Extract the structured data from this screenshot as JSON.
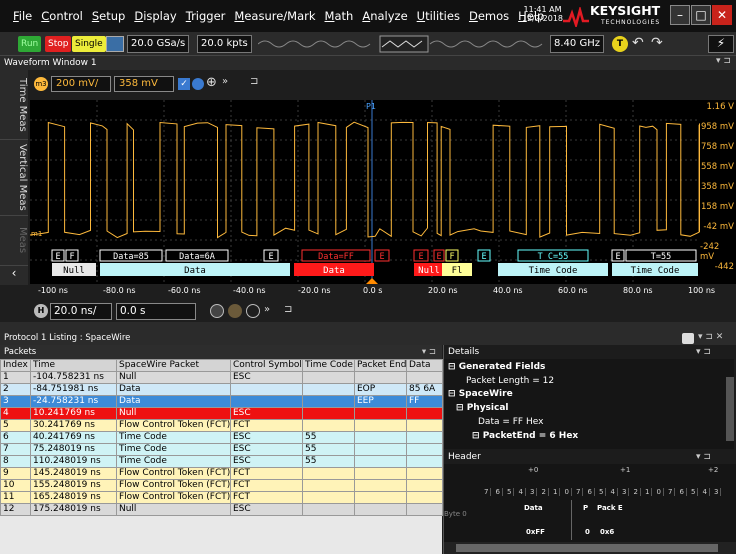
{
  "menu": {
    "items": [
      "File",
      "Control",
      "Setup",
      "Display",
      "Trigger",
      "Measure/Mark",
      "Math",
      "Analyze",
      "Utilities",
      "Demos",
      "Help"
    ]
  },
  "clock": {
    "time": "11:41 AM",
    "date": "12/2/2018"
  },
  "brand": {
    "name": "KEYSIGHT",
    "sub": "TECHNOLOGIES"
  },
  "toolbar": {
    "run": "Run",
    "stop": "Stop",
    "single": "Single",
    "sample_rate": "20.0 GSa/s",
    "points": "20.0 kpts",
    "bandwidth": "8.40 GHz",
    "trigger_badge": "T"
  },
  "window": {
    "title": "Waveform Window 1"
  },
  "sidetabs": [
    "Time Meas",
    "Vertical Meas",
    "Meas"
  ],
  "channel": {
    "badge": "m3",
    "scale": "200 mV/",
    "offset": "358 mV",
    "marker": "P1",
    "ref_label": "m1"
  },
  "voltage_labels": [
    "1.16 V",
    "958 mV",
    "758 mV",
    "558 mV",
    "358 mV",
    "158 mV",
    "-42 mV",
    "-242 mV",
    "-442"
  ],
  "time_labels": [
    "-100 ns",
    "-80.0 ns",
    "-60.0 ns",
    "-40.0 ns",
    "-20.0 ns",
    "0.0 s",
    "20.0 ns",
    "40.0 ns",
    "60.0 ns",
    "80.0 ns",
    "100 ns"
  ],
  "horizontal": {
    "badge": "H",
    "scale": "20.0 ns/",
    "position": "0.0 s"
  },
  "decode": {
    "row1": [
      {
        "text": "E",
        "color": "#ffffff",
        "bg": "#000"
      },
      {
        "text": "F",
        "color": "#ffffff",
        "bg": "#000"
      },
      {
        "text": "Data=85",
        "color": "#ffffff",
        "bg": "#000"
      },
      {
        "text": "Data=6A",
        "color": "#ffffff",
        "bg": "#000"
      },
      {
        "text": "E",
        "color": "#ffffff",
        "bg": "#000"
      },
      {
        "text": "Data=FF",
        "color": "#ff3030",
        "bg": "#000"
      },
      {
        "text": "E",
        "color": "#ff3030",
        "bg": "#000"
      },
      {
        "text": "E",
        "color": "#ff3030",
        "bg": "#000"
      },
      {
        "text": "E",
        "color": "#ff3030",
        "bg": "#000"
      },
      {
        "text": "F",
        "color": "#ffff66",
        "bg": "#000"
      },
      {
        "text": "E",
        "color": "#66ffff",
        "bg": "#000"
      },
      {
        "text": "T C=55",
        "color": "#66ffff",
        "bg": "#000"
      },
      {
        "text": "E",
        "color": "#ffffff",
        "bg": "#000"
      },
      {
        "text": "T=55",
        "color": "#ffffff",
        "bg": "#000"
      }
    ],
    "row2": [
      "Null",
      "Data",
      "Data",
      "Null",
      "Fl",
      "Time Code",
      "Time Code"
    ]
  },
  "listing": {
    "title": "Protocol 1 Listing : SpaceWire",
    "packets_label": "Packets",
    "columns": [
      "Index",
      "Time",
      "SpaceWire Packet",
      "Control Symbol",
      "Time Code",
      "Packet End",
      "Data"
    ],
    "rows": [
      {
        "c": [
          "1",
          "-104.758231 ns",
          "Null",
          "ESC",
          "",
          "",
          ""
        ],
        "bg": "#d9d9d9",
        "fg": "#000"
      },
      {
        "c": [
          "2",
          "-84.751981 ns",
          "Data",
          "",
          "",
          "EOP",
          "85 6A"
        ],
        "bg": "#cfe8f7",
        "fg": "#000"
      },
      {
        "c": [
          "3",
          "-24.758231 ns",
          "Data",
          "",
          "",
          "EEP",
          "FF"
        ],
        "bg": "#3d8bd8",
        "fg": "#fff"
      },
      {
        "c": [
          "4",
          "10.241769 ns",
          "Null",
          "ESC",
          "",
          "",
          ""
        ],
        "bg": "#ee1111",
        "fg": "#fff"
      },
      {
        "c": [
          "5",
          "30.241769 ns",
          "Flow Control Token (FCT)",
          "FCT",
          "",
          "",
          ""
        ],
        "bg": "#fff3b8",
        "fg": "#000"
      },
      {
        "c": [
          "6",
          "40.241769 ns",
          "Time Code",
          "ESC",
          "55",
          "",
          ""
        ],
        "bg": "#cff3f5",
        "fg": "#000"
      },
      {
        "c": [
          "7",
          "75.248019 ns",
          "Time Code",
          "ESC",
          "55",
          "",
          ""
        ],
        "bg": "#cff3f5",
        "fg": "#000"
      },
      {
        "c": [
          "8",
          "110.248019 ns",
          "Time Code",
          "ESC",
          "55",
          "",
          ""
        ],
        "bg": "#cff3f5",
        "fg": "#000"
      },
      {
        "c": [
          "9",
          "145.248019 ns",
          "Flow Control Token (FCT)",
          "FCT",
          "",
          "",
          ""
        ],
        "bg": "#fff3b8",
        "fg": "#000"
      },
      {
        "c": [
          "10",
          "155.248019 ns",
          "Flow Control Token (FCT)",
          "FCT",
          "",
          "",
          ""
        ],
        "bg": "#fff3b8",
        "fg": "#000"
      },
      {
        "c": [
          "11",
          "165.248019 ns",
          "Flow Control Token (FCT)",
          "FCT",
          "",
          "",
          ""
        ],
        "bg": "#fff3b8",
        "fg": "#000"
      },
      {
        "c": [
          "12",
          "175.248019 ns",
          "Null",
          "ESC",
          "",
          "",
          ""
        ],
        "bg": "#d9d9d9",
        "fg": "#000"
      }
    ]
  },
  "details": {
    "title": "Details",
    "lines": [
      "Generated Fields",
      "Packet Length = 12",
      "SpaceWire",
      "Physical",
      "Data = FF Hex",
      "PacketEnd = 6 Hex"
    ]
  },
  "header": {
    "title": "Header",
    "offsets": [
      "+0",
      "+1",
      "+2"
    ],
    "bits": [
      "7",
      "6",
      "5",
      "4",
      "3",
      "2",
      "1",
      "0",
      "7",
      "6",
      "5",
      "4",
      "3",
      "2",
      "1",
      "0",
      "7",
      "6",
      "5",
      "4",
      "3"
    ],
    "byte_label": "Byte 0",
    "fields": [
      "Data",
      "P",
      "Pack E"
    ],
    "values": [
      "0xFF",
      "0",
      "0x6"
    ]
  },
  "colors": {
    "trace": "#fdb93c",
    "accent": "#fdb93c",
    "grid": "#3a3a3a"
  }
}
